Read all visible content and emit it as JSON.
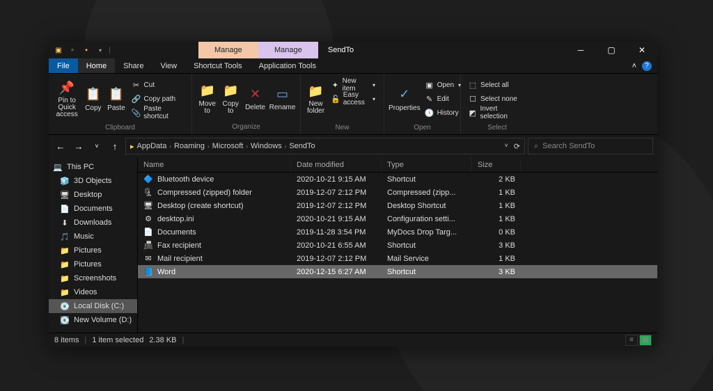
{
  "window": {
    "title": "SendTo",
    "context_tabs": [
      {
        "label": "Manage"
      },
      {
        "label": "Manage"
      }
    ]
  },
  "tabs": {
    "file": "File",
    "home": "Home",
    "share": "Share",
    "view": "View",
    "shortcut_tools": "Shortcut Tools",
    "app_tools": "Application Tools"
  },
  "ribbon": {
    "clipboard": {
      "label": "Clipboard",
      "pin": "Pin to Quick\naccess",
      "copy": "Copy",
      "paste": "Paste",
      "cut": "Cut",
      "copy_path": "Copy path",
      "paste_shortcut": "Paste shortcut"
    },
    "organize": {
      "label": "Organize",
      "move": "Move\nto",
      "copy": "Copy\nto",
      "delete": "Delete",
      "rename": "Rename"
    },
    "new": {
      "label": "New",
      "new_folder": "New\nfolder",
      "new_item": "New item",
      "easy_access": "Easy access"
    },
    "open": {
      "label": "Open",
      "properties": "Properties",
      "open": "Open",
      "edit": "Edit",
      "history": "History"
    },
    "select": {
      "label": "Select",
      "select_all": "Select all",
      "select_none": "Select none",
      "invert": "Invert selection"
    }
  },
  "breadcrumbs": [
    "AppData",
    "Roaming",
    "Microsoft",
    "Windows",
    "SendTo"
  ],
  "search": {
    "placeholder": "Search SendTo"
  },
  "tree": [
    {
      "icon": "💻",
      "label": "This PC"
    },
    {
      "icon": "🧊",
      "label": "3D Objects"
    },
    {
      "icon": "🖥",
      "label": "Desktop"
    },
    {
      "icon": "📄",
      "label": "Documents"
    },
    {
      "icon": "⬇",
      "label": "Downloads"
    },
    {
      "icon": "🎵",
      "label": "Music"
    },
    {
      "icon": "📁",
      "label": "Pictures"
    },
    {
      "icon": "📁",
      "label": "Pictures"
    },
    {
      "icon": "📁",
      "label": "Screenshots"
    },
    {
      "icon": "📁",
      "label": "Videos"
    },
    {
      "icon": "💽",
      "label": "Local Disk (C:)",
      "selected": true
    },
    {
      "icon": "💽",
      "label": "New Volume (D:)"
    }
  ],
  "columns": {
    "name": "Name",
    "date": "Date modified",
    "type": "Type",
    "size": "Size"
  },
  "files": [
    {
      "icon": "🔷",
      "name": "Bluetooth device",
      "date": "2020-10-21 9:15 AM",
      "type": "Shortcut",
      "size": "2 KB"
    },
    {
      "icon": "🗜",
      "name": "Compressed (zipped) folder",
      "date": "2019-12-07 2:12 PM",
      "type": "Compressed (zipp...",
      "size": "1 KB"
    },
    {
      "icon": "🖥",
      "name": "Desktop (create shortcut)",
      "date": "2019-12-07 2:12 PM",
      "type": "Desktop Shortcut",
      "size": "1 KB"
    },
    {
      "icon": "⚙",
      "name": "desktop.ini",
      "date": "2020-10-21 9:15 AM",
      "type": "Configuration setti...",
      "size": "1 KB"
    },
    {
      "icon": "📄",
      "name": "Documents",
      "date": "2019-11-28 3:54 PM",
      "type": "MyDocs Drop Targ...",
      "size": "0 KB"
    },
    {
      "icon": "📠",
      "name": "Fax recipient",
      "date": "2020-10-21 6:55 AM",
      "type": "Shortcut",
      "size": "3 KB"
    },
    {
      "icon": "✉",
      "name": "Mail recipient",
      "date": "2019-12-07 2:12 PM",
      "type": "Mail Service",
      "size": "1 KB"
    },
    {
      "icon": "📘",
      "name": "Word",
      "date": "2020-12-15 6:27 AM",
      "type": "Shortcut",
      "size": "3 KB",
      "selected": true
    }
  ],
  "status": {
    "items": "8 items",
    "selected": "1 item selected",
    "size": "2.38 KB"
  }
}
